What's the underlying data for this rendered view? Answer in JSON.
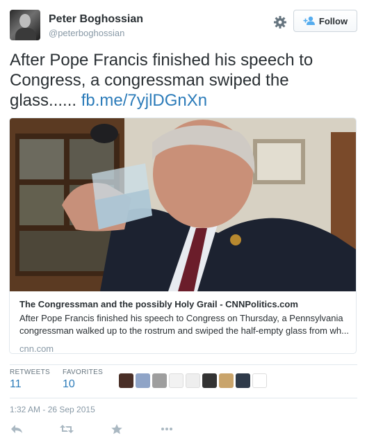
{
  "user": {
    "name": "Peter Boghossian",
    "handle": "@peterboghossian",
    "follow_label": "Follow"
  },
  "tweet": {
    "text": "After Pope Francis finished his speech to Congress, a congressman swiped the glass...... ",
    "link": "fb.me/7yjlDGnXn"
  },
  "card": {
    "title": "The Congressman and the possibly Holy Grail - CNNPolitics.com",
    "description": "After Pope Francis finished his speech to Congress on Thursday, a Pennsylvania congressman walked up to the rostrum and swiped the half-empty glass from wh...",
    "domain": "cnn.com"
  },
  "stats": {
    "retweets_label": "RETWEETS",
    "retweets_count": "11",
    "favorites_label": "FAVORITES",
    "favorites_count": "10"
  },
  "timestamp": "1:32 AM - 26 Sep 2015",
  "colors": {
    "link": "#2b7bb9",
    "muted": "#8899a6",
    "border": "#e1e8ed"
  },
  "icons": [
    "gear-icon",
    "follow-user-icon",
    "reply-icon",
    "retweet-icon",
    "favorite-icon",
    "more-icon"
  ]
}
